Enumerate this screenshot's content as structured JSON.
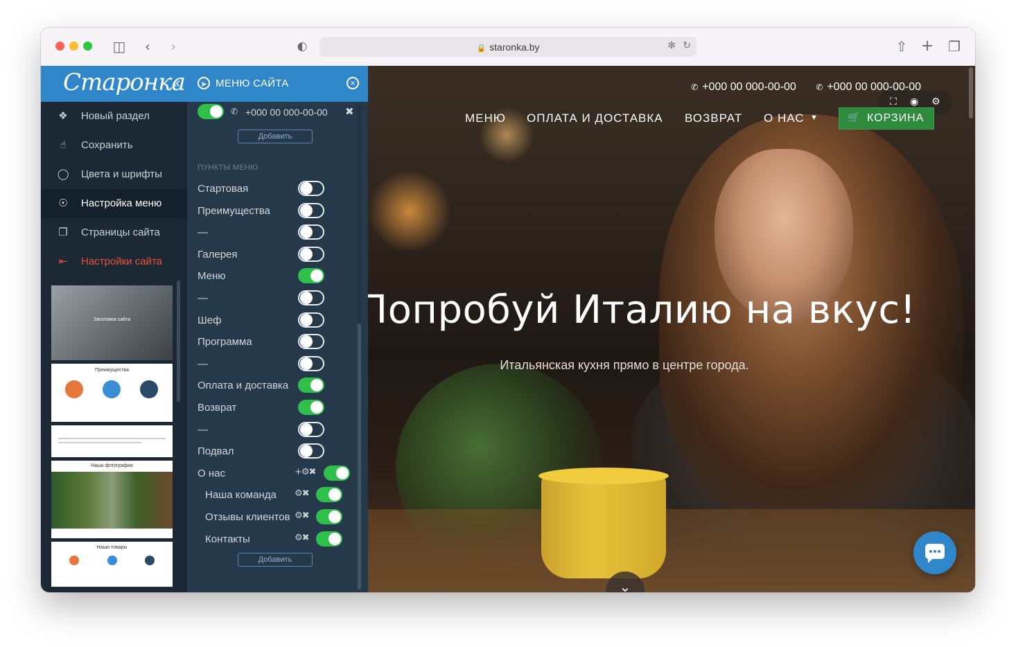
{
  "browser": {
    "url": "staronka.by"
  },
  "sidebar": {
    "logo": "Старонка",
    "items": [
      {
        "label": "Новый раздел",
        "icon": "tag-icon"
      },
      {
        "label": "Сохранить",
        "icon": "thumbs-up-icon"
      },
      {
        "label": "Цвета и шрифты",
        "icon": "lightbulb-icon"
      },
      {
        "label": "Настройка меню",
        "icon": "compass-icon",
        "active": true
      },
      {
        "label": "Страницы сайта",
        "icon": "pages-icon"
      },
      {
        "label": "Настройки сайта",
        "icon": "exit-icon",
        "danger": true
      }
    ],
    "thumbnails": [
      {
        "title": "Заголовок сайта"
      },
      {
        "title": "Преимущества"
      },
      {
        "title": ""
      },
      {
        "title": "Наши фотографии"
      },
      {
        "title": "Наши товары"
      }
    ]
  },
  "menu_panel": {
    "title": "МЕНЮ САЙТА",
    "phone": "+000 00 000-00-00",
    "add_label": "Добавить",
    "section_label": "ПУНКТЫ МЕНЮ",
    "items": [
      {
        "label": "Стартовая",
        "on": false
      },
      {
        "label": "Преимущества",
        "on": false
      },
      {
        "label": "—",
        "on": false
      },
      {
        "label": "Галерея",
        "on": false
      },
      {
        "label": "Меню",
        "on": true
      },
      {
        "label": "—",
        "on": false
      },
      {
        "label": "Шеф",
        "on": false
      },
      {
        "label": "Программа",
        "on": false
      },
      {
        "label": "—",
        "on": false
      },
      {
        "label": "Оплата и доставка",
        "on": true
      },
      {
        "label": "Возврат",
        "on": true
      },
      {
        "label": "—",
        "on": false
      },
      {
        "label": "Подвал",
        "on": false
      },
      {
        "label": "О нас",
        "on": true
      },
      {
        "label": "Наша команда",
        "on": true,
        "sub": true
      },
      {
        "label": "Отзывы клиентов",
        "on": true,
        "sub": true
      },
      {
        "label": "Контакты",
        "on": true,
        "sub": true
      }
    ],
    "add_label_bottom": "Добавить"
  },
  "site": {
    "phones": [
      "+000 00 000-00-00",
      "+000 00 000-00-00"
    ],
    "nav": [
      "МЕНЮ",
      "ОПЛАТА И ДОСТАВКА",
      "ВОЗВРАТ",
      "О НАС"
    ],
    "cart": "КОРЗИНА",
    "hero_title": "Попробуй Италию на вкус!",
    "hero_subtitle": "Итальянская кухня прямо в центре города."
  },
  "colors": {
    "accent": "#2f86c9",
    "sidebar_bg": "#1c2833",
    "panel_bg": "#26394a",
    "toggle_on": "#2fbf4b",
    "cart_bg": "#2e8b3e",
    "danger": "#e5533d"
  }
}
